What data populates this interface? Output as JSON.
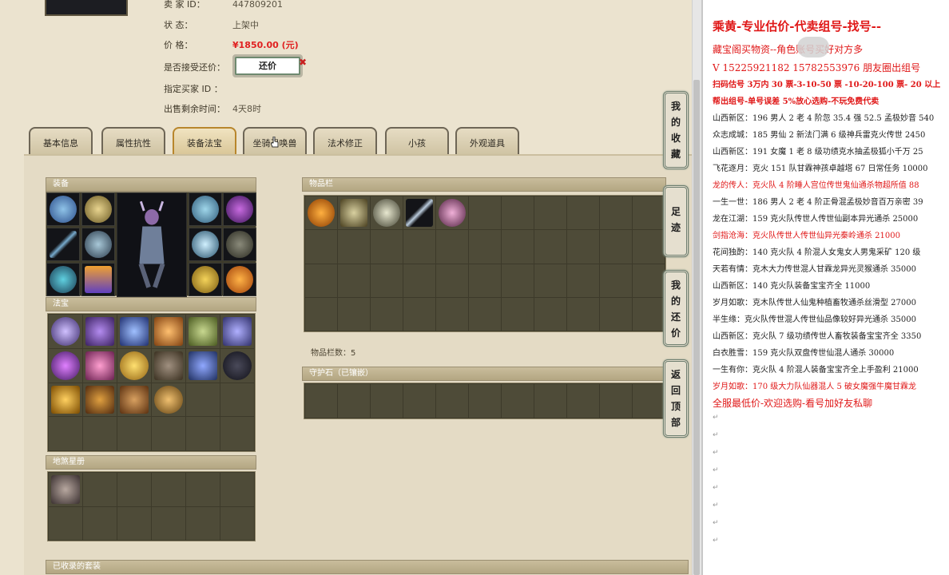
{
  "info": {
    "seller_label": "卖 家 ID：",
    "seller_id": "447809201",
    "status_label": "状 态：",
    "status_value": "上架中",
    "price_label": "价 格：",
    "price_value": "¥1850.00 (元)",
    "counter_label": "是否接受还价：",
    "counter_button": "还价",
    "counter_mark": "✖",
    "buyer_label": "指定买家 ID ：",
    "remaining_label": "出售剩余时间：",
    "remaining_value": "4天8时"
  },
  "tabs": [
    {
      "label": "基本信息",
      "active": false
    },
    {
      "label": "属性抗性",
      "active": false
    },
    {
      "label": "装备法宝",
      "active": true
    },
    {
      "label": "坐骑召唤兽",
      "active": false
    },
    {
      "label": "法术修正",
      "active": false
    },
    {
      "label": "小孩",
      "active": false
    },
    {
      "label": "外观道具",
      "active": false
    }
  ],
  "panels": {
    "equipment": "装备",
    "treasure": "法宝",
    "carry": "地煞星册",
    "inventory": "物品栏",
    "guard": "守护石（已镶嵌）",
    "collected": "已收录的套装"
  },
  "inventory_count": "物品栏数：5",
  "side_buttons": [
    {
      "label": "我的收藏"
    },
    {
      "label": "足迹"
    },
    {
      "label": "我的还价"
    },
    {
      "label": "返回顶部"
    }
  ],
  "colors": {
    "accent_red": "#e01818",
    "tab_active": "#b8862c",
    "panel_dark": "#4e4b38"
  },
  "notes": {
    "title": "乘黄-专业估价-代卖组号-找号--",
    "lines": [
      {
        "text": "藏宝阁买物资--角色账号买好对方多",
        "style": "mid"
      },
      {
        "text": "V 15225921182 15782553976 朋友圈出组号",
        "style": "mid"
      },
      {
        "text": "扫码估号 3万内 30 票-3-10-50 票 -10-20-100 票- 20 以上",
        "style": "bold"
      },
      {
        "text": "帮出组号-单号误差 5%放心选购-不玩免费代卖",
        "style": "bold"
      },
      {
        "text": "山西新区：196 男人 2 老 4 阶忽 35.4 强 52.5 孟极妙音 540",
        "style": "normal"
      },
      {
        "text": "众志成城：185 男仙 2 新法门满 6 级神兵雷克火传世 2450",
        "style": "normal"
      },
      {
        "text": "山西新区：191 女魔 1 老 8 级功绩克水抽孟极狐小千万 25",
        "style": "normal"
      },
      {
        "text": "飞花逐月：克火 151 队甘霖神孩卓越塔 67 日常任务 10000",
        "style": "normal"
      },
      {
        "text": "龙的传人：克火队 4 阶睡人宫位传世鬼仙通杀物超所值 88",
        "style": "red"
      },
      {
        "text": "一生一世：186 男人 2 老 4 阶正骨混孟极妙音百万亲密 39",
        "style": "normal"
      },
      {
        "text": "龙在江湖：159 克火队传世人传世仙副本异光通杀 25000",
        "style": "normal"
      },
      {
        "text": "剑指沧海：克火队传世人传世仙异光秦岭通杀 21000",
        "style": "red"
      },
      {
        "text": "花间独酌：140 克火队 4 阶混人女鬼女人男鬼采矿 120 级",
        "style": "normal"
      },
      {
        "text": "天若有情：克木大力传世混人甘霖龙异光灵猴通杀 35000",
        "style": "normal"
      },
      {
        "text": "山西新区：140 克火队装备宝宝齐全 11000",
        "style": "normal"
      },
      {
        "text": "岁月如歌：克木队传世人仙鬼种植畜牧通杀丝滑型 27000",
        "style": "normal"
      },
      {
        "text": "半生缘：克火队传世混人传世仙品像较好异光通杀 35000",
        "style": "normal"
      },
      {
        "text": "山西新区：克火队 7 级功绩传世人畜牧装备宝宝齐全 3350",
        "style": "normal"
      },
      {
        "text": "白衣胜雪：159 克火队双盘传世仙混人通杀 30000",
        "style": "normal"
      },
      {
        "text": "一生有你：克火队 4 阶混人装备宝宝齐全上手盈利 21000",
        "style": "normal"
      },
      {
        "text": "岁月如歌：170 级大力队仙器混人 5 破女魔强牛魔甘霖龙",
        "style": "red"
      },
      {
        "text": "全服最低价-欢迎选购-看号加好友私聊",
        "style": "mid"
      }
    ],
    "para_mark": "↵"
  }
}
